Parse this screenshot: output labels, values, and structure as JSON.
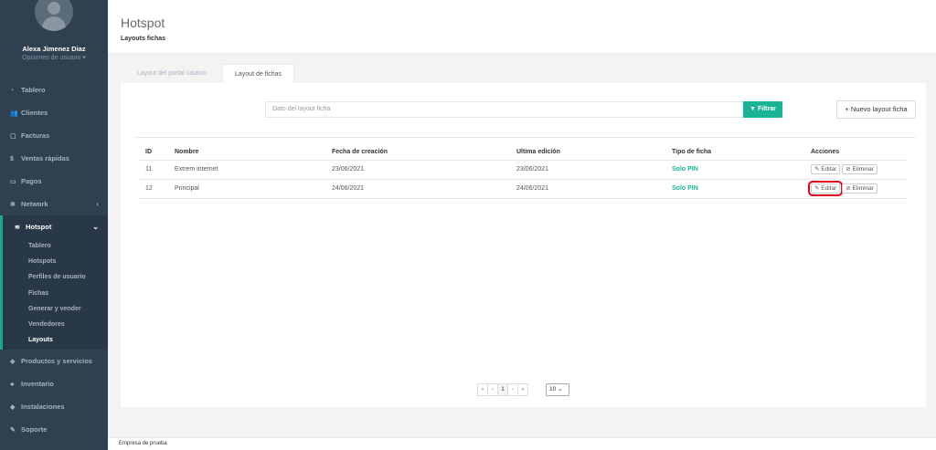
{
  "profile": {
    "name": "Alexa Jimenez Diaz",
    "options": "Opciones de usuario ▾"
  },
  "nav": {
    "items": [
      {
        "icon": "◔",
        "label": "Tablero"
      },
      {
        "icon": "👥",
        "label": "Clientes"
      },
      {
        "icon": "▢",
        "label": "Facturas"
      },
      {
        "icon": "$",
        "label": "Ventas rápidas"
      },
      {
        "icon": "▭",
        "label": "Pagos"
      },
      {
        "icon": "✻",
        "label": "Network",
        "chevron": "‹"
      }
    ],
    "active": {
      "icon": "≋",
      "label": "Hotspot",
      "chevron": "⌄"
    },
    "sub": [
      "Tablero",
      "Hotspots",
      "Perfiles de usuario",
      "Fichas",
      "Generar y vender",
      "Vendedores",
      "Layouts"
    ],
    "bottom": [
      {
        "icon": "◈",
        "label": "Productos y servicios"
      },
      {
        "icon": "♣",
        "label": "Inventario"
      },
      {
        "icon": "◆",
        "label": "Instalaciones"
      },
      {
        "icon": "✎",
        "label": "Soporte"
      }
    ]
  },
  "header": {
    "title": "Hotspot",
    "crumb": "Layouts fichas"
  },
  "tabs": [
    "Layout del portal cautivo",
    "Layout de fichas"
  ],
  "toolbar": {
    "search_placeholder": "Dato del layout ficha",
    "filter": "▼ Filtrar",
    "new": "+ Nuevo layout ficha"
  },
  "table": {
    "headers": [
      "ID",
      "Nombre",
      "Fecha de creación",
      "Ultima edición",
      "Tipo de ficha",
      "Acciones"
    ],
    "rows": [
      {
        "id": "11",
        "nombre": "Extrem internet",
        "creacion": "23/06/2021",
        "edicion": "23/06/2021",
        "tipo": "Solo PIN"
      },
      {
        "id": "12",
        "nombre": "Principal",
        "creacion": "24/06/2021",
        "edicion": "24/06/2021",
        "tipo": "Solo PIN"
      }
    ],
    "edit": "✎ Editar",
    "delete": "⊘ Eliminar"
  },
  "pager": {
    "first": "«",
    "prev": "‹",
    "page": "1",
    "next": "›",
    "last": "»",
    "size": "10 ⌄"
  },
  "footer": "Empresa de prueba",
  "colors": {
    "sidebar": "#2f4050",
    "accent": "#1ab394",
    "highlight": "#e2001a"
  }
}
